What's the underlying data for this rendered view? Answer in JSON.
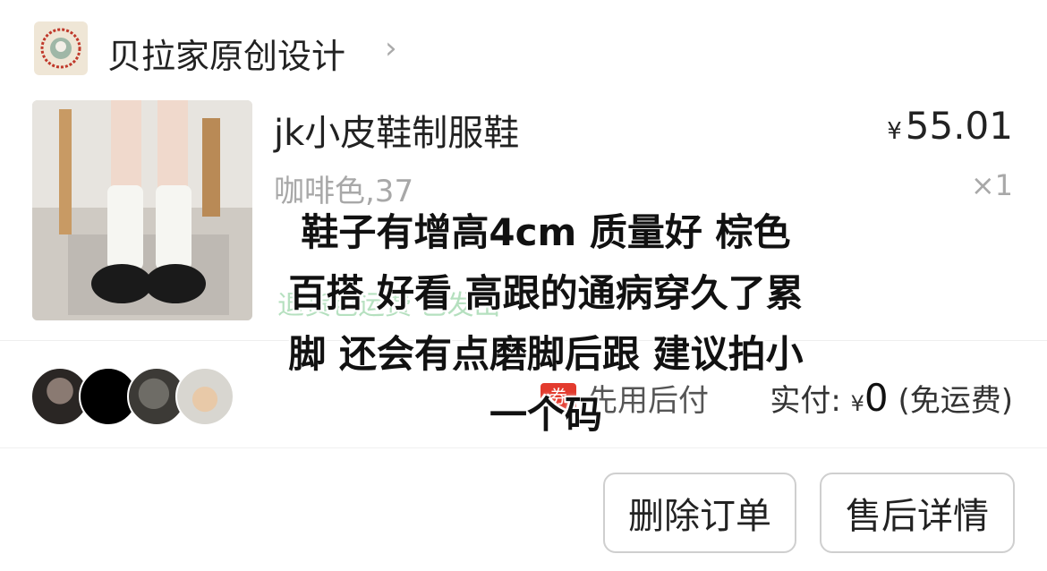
{
  "shop": {
    "name": "贝拉家原创设计",
    "chevron": "›",
    "logo_icon": "shop-logo-icon"
  },
  "product": {
    "title": "jk小皮鞋制服鞋",
    "spec": "咖啡色,37",
    "price_symbol": "¥",
    "price": "55.01",
    "quantity": "×1",
    "faded_text": "退货包运费 已发出"
  },
  "payment": {
    "coupon": "券",
    "method": "先用后付",
    "paid_label": "实付:",
    "currency": "¥",
    "amount": "0",
    "shipping_note": "(免运费)"
  },
  "buttons": {
    "delete_order": "删除订单",
    "after_sale": "售后详情"
  },
  "caption": {
    "lines": [
      "鞋子有增高4cm 质量好 棕色",
      "百搭 好看 高跟的通病穿久了累",
      "脚 还会有点磨脚后跟 建议拍小",
      "一个码"
    ]
  },
  "colors": {
    "coupon_red": "#e33b2e",
    "muted_gray": "#a8a8a8"
  }
}
